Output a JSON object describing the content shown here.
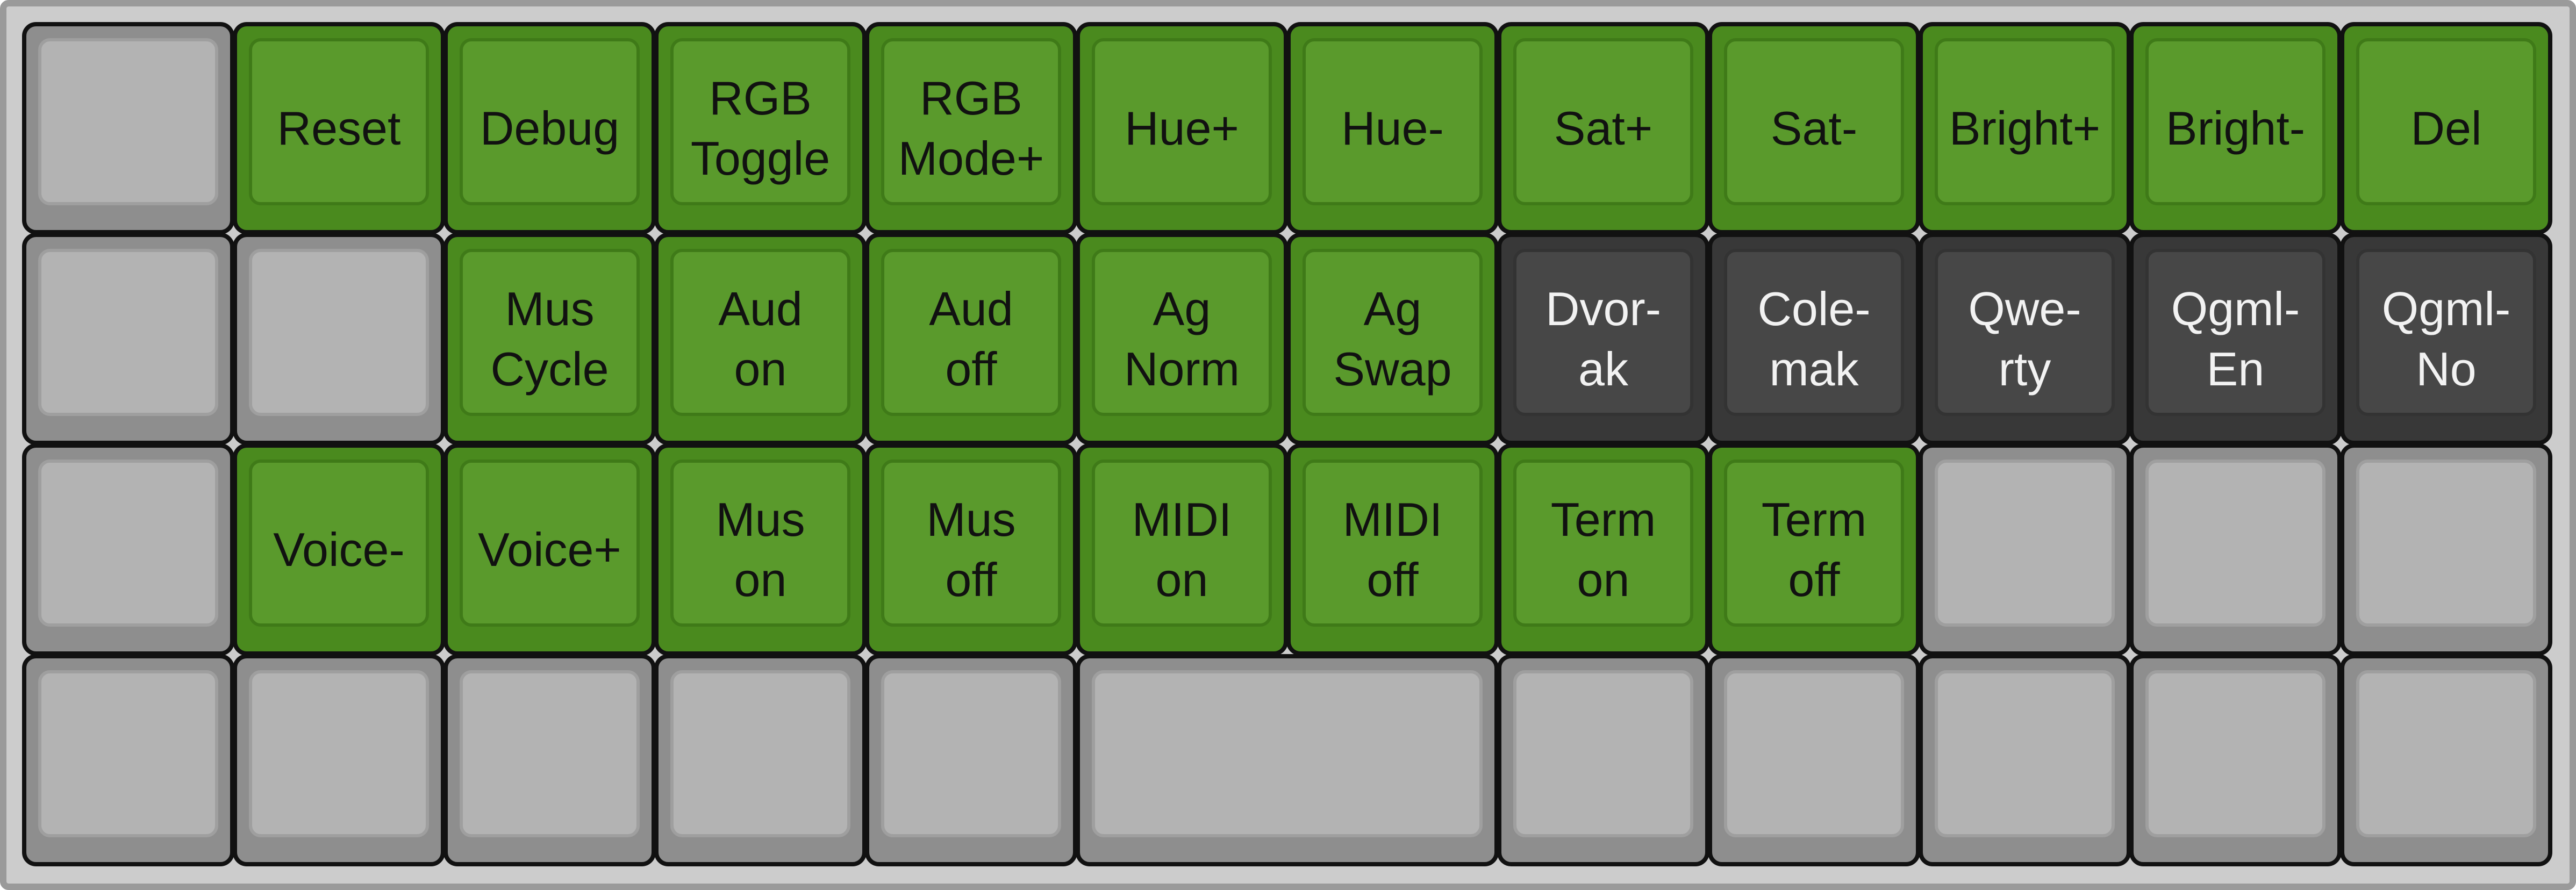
{
  "keyboard": {
    "colors": {
      "green": "#5a9a2c",
      "grey": "#b3b3b3",
      "dark": "#474747",
      "frame": "#cccccc"
    },
    "rows": [
      [
        {
          "label": "",
          "style": "grey",
          "span": 1
        },
        {
          "label": "Reset",
          "style": "green",
          "span": 1
        },
        {
          "label": "Debug",
          "style": "green",
          "span": 1
        },
        {
          "label": "RGB\nToggle",
          "style": "green",
          "span": 1
        },
        {
          "label": "RGB\nMode+",
          "style": "green",
          "span": 1
        },
        {
          "label": "Hue+",
          "style": "green",
          "span": 1
        },
        {
          "label": "Hue-",
          "style": "green",
          "span": 1
        },
        {
          "label": "Sat+",
          "style": "green",
          "span": 1
        },
        {
          "label": "Sat-",
          "style": "green",
          "span": 1
        },
        {
          "label": "Bright+",
          "style": "green",
          "span": 1
        },
        {
          "label": "Bright-",
          "style": "green",
          "span": 1
        },
        {
          "label": "Del",
          "style": "green",
          "span": 1
        }
      ],
      [
        {
          "label": "",
          "style": "grey",
          "span": 1
        },
        {
          "label": "",
          "style": "grey",
          "span": 1
        },
        {
          "label": "Mus\nCycle",
          "style": "green",
          "span": 1
        },
        {
          "label": "Aud\non",
          "style": "green",
          "span": 1
        },
        {
          "label": "Aud\noff",
          "style": "green",
          "span": 1
        },
        {
          "label": "Ag\nNorm",
          "style": "green",
          "span": 1
        },
        {
          "label": "Ag\nSwap",
          "style": "green",
          "span": 1
        },
        {
          "label": "Dvor-\nak",
          "style": "dark",
          "span": 1
        },
        {
          "label": "Cole-\nmak",
          "style": "dark",
          "span": 1
        },
        {
          "label": "Qwe-\nrty",
          "style": "dark",
          "span": 1
        },
        {
          "label": "Qgml-\nEn",
          "style": "dark",
          "span": 1
        },
        {
          "label": "Qgml-\nNo",
          "style": "dark",
          "span": 1
        }
      ],
      [
        {
          "label": "",
          "style": "grey",
          "span": 1
        },
        {
          "label": "Voice-",
          "style": "green",
          "span": 1
        },
        {
          "label": "Voice+",
          "style": "green",
          "span": 1
        },
        {
          "label": "Mus\non",
          "style": "green",
          "span": 1
        },
        {
          "label": "Mus\noff",
          "style": "green",
          "span": 1
        },
        {
          "label": "MIDI\non",
          "style": "green",
          "span": 1
        },
        {
          "label": "MIDI\noff",
          "style": "green",
          "span": 1
        },
        {
          "label": "Term\non",
          "style": "green",
          "span": 1
        },
        {
          "label": "Term\noff",
          "style": "green",
          "span": 1
        },
        {
          "label": "",
          "style": "grey",
          "span": 1
        },
        {
          "label": "",
          "style": "grey",
          "span": 1
        },
        {
          "label": "",
          "style": "grey",
          "span": 1
        }
      ],
      [
        {
          "label": "",
          "style": "grey",
          "span": 1
        },
        {
          "label": "",
          "style": "grey",
          "span": 1
        },
        {
          "label": "",
          "style": "grey",
          "span": 1
        },
        {
          "label": "",
          "style": "grey",
          "span": 1
        },
        {
          "label": "",
          "style": "grey",
          "span": 1
        },
        {
          "label": "",
          "style": "grey",
          "span": 2
        },
        {
          "label": "",
          "style": "grey",
          "span": 1
        },
        {
          "label": "",
          "style": "grey",
          "span": 1
        },
        {
          "label": "",
          "style": "grey",
          "span": 1
        },
        {
          "label": "",
          "style": "grey",
          "span": 1
        },
        {
          "label": "",
          "style": "grey",
          "span": 1
        }
      ]
    ]
  }
}
